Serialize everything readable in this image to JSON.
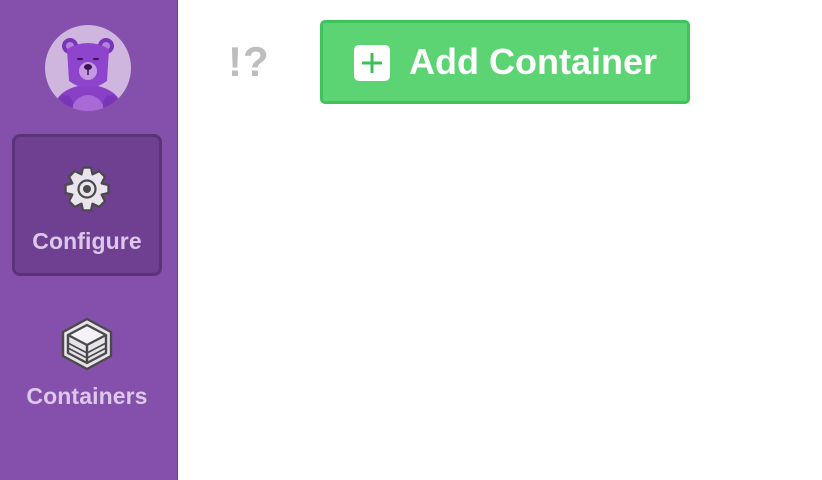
{
  "sidebar": {
    "avatar_icon": "bear-avatar-icon",
    "items": [
      {
        "label": "Configure",
        "icon": "gear-icon",
        "active": true
      },
      {
        "label": "Containers",
        "icon": "box-icon",
        "active": false
      }
    ]
  },
  "main": {
    "help_glyph": "!?",
    "add_button": {
      "label": "Add Container",
      "icon": "plus-icon"
    }
  },
  "colors": {
    "sidebar_bg": "#8550ac",
    "sidebar_active_bg": "#6f3f92",
    "nav_label": "#dcc8ea",
    "button_green": "#5cd474",
    "help_grey": "#bdbdbd"
  }
}
